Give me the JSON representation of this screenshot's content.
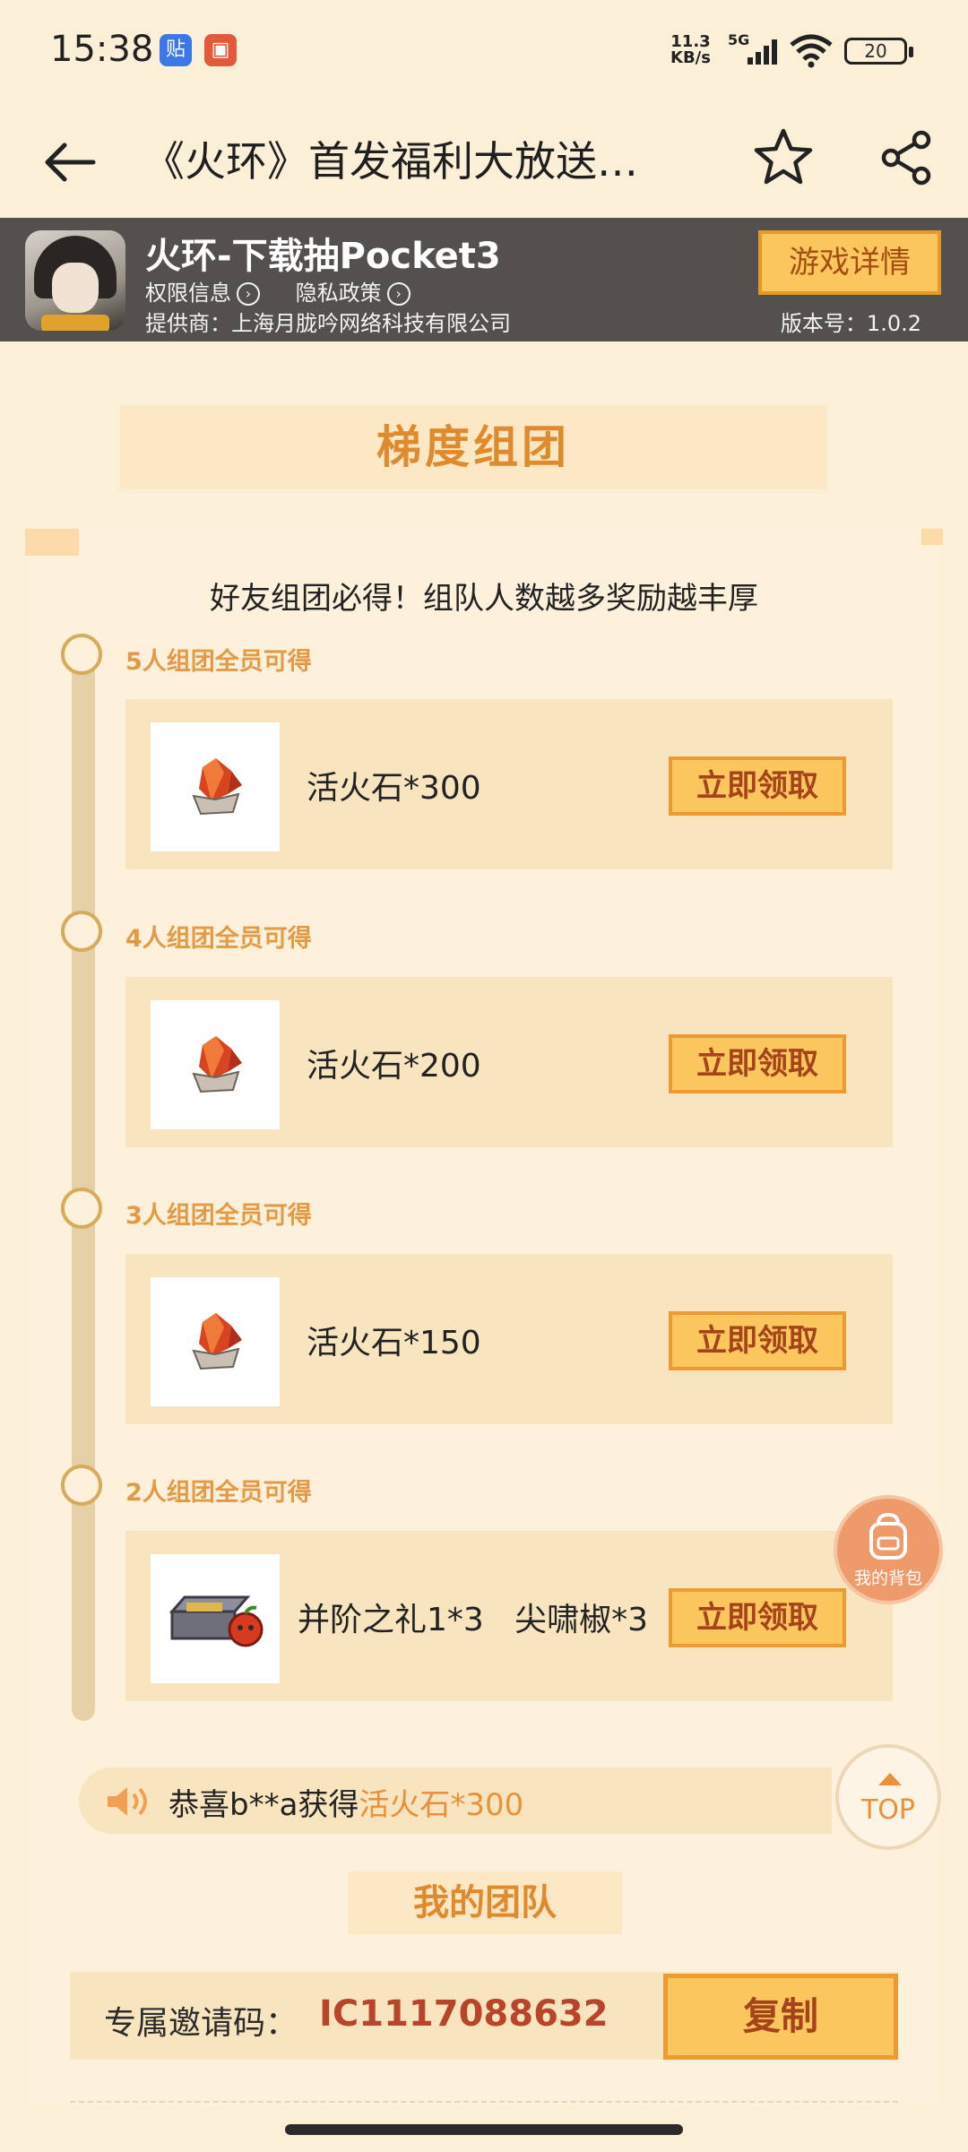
{
  "status_bar": {
    "time": "15:38",
    "notif_badges": [
      "贴",
      "▣"
    ],
    "net_speed_top": "11.3",
    "net_speed_bottom": "KB/s",
    "network": "5G",
    "battery": "20"
  },
  "nav": {
    "title": "《火环》首发福利大放送…",
    "icons": [
      "back-arrow-icon",
      "star-icon",
      "share-icon"
    ]
  },
  "banner": {
    "game_name": "火环-下载抽Pocket3",
    "permissions_link": "权限信息",
    "privacy_link": "隐私政策",
    "provider": "提供商：上海月胧吟网络科技有限公司",
    "detail_button": "游戏详情",
    "version": "版本号：1.0.2"
  },
  "section": {
    "title": "梯度组团",
    "subtitle": "好友组团必得！组队人数越多奖励越丰厚"
  },
  "tiers": [
    {
      "label": "5人组团全员可得",
      "reward": "活火石*300",
      "button": "立即领取"
    },
    {
      "label": "4人组团全员可得",
      "reward": "活火石*200",
      "button": "立即领取"
    },
    {
      "label": "3人组团全员可得",
      "reward": "活火石*150",
      "button": "立即领取"
    },
    {
      "label": "2人组团全员可得",
      "reward": "并阶之礼1*3   尖啸椒*3",
      "button": "立即领取"
    }
  ],
  "floating": {
    "bag_label": "我的背包",
    "top_label": "TOP"
  },
  "ticker": {
    "prefix": "恭喜b**a获得",
    "highlight": "活火石*300"
  },
  "team": {
    "title": "我的团队",
    "invite_label": "专属邀请码：",
    "invite_code": "IC1117088632",
    "copy_button": "复制"
  },
  "colors": {
    "page_bg": "#fbefd8",
    "accent_orange": "#e08a2e",
    "button_fill": "#fbc65e",
    "button_border": "#ee9a34",
    "code_red": "#b8442a"
  }
}
